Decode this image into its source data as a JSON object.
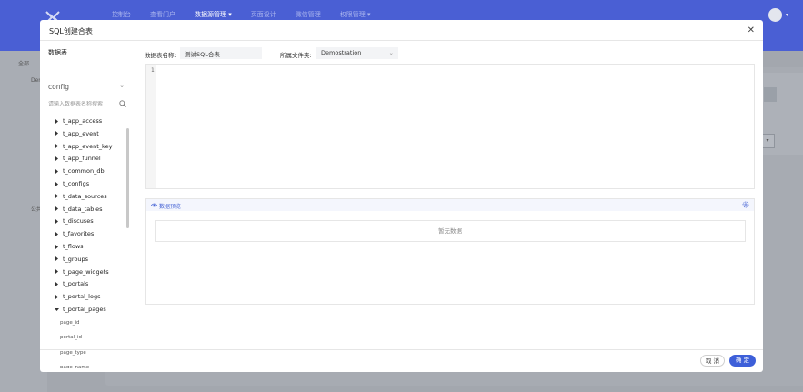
{
  "topbar": {
    "nav": [
      {
        "label": "控制台",
        "active": false
      },
      {
        "label": "查看门户",
        "active": false
      },
      {
        "label": "数据源管理 ▾",
        "active": true
      },
      {
        "label": "页面设计",
        "active": false
      },
      {
        "label": "微信管理",
        "active": false
      },
      {
        "label": "权限管理 ▾",
        "active": false
      }
    ]
  },
  "background": {
    "sidebar": [
      "全部",
      "Dem",
      "公共"
    ]
  },
  "dialog": {
    "title": "SQL创建合表",
    "left": {
      "label": "数据表",
      "source_value": "config",
      "search_placeholder": "请输入数据表名称搜索",
      "tables": [
        {
          "name": "t_app_access",
          "expanded": false
        },
        {
          "name": "t_app_event",
          "expanded": false
        },
        {
          "name": "t_app_event_key",
          "expanded": false
        },
        {
          "name": "t_app_funnel",
          "expanded": false
        },
        {
          "name": "t_common_db",
          "expanded": false
        },
        {
          "name": "t_configs",
          "expanded": false
        },
        {
          "name": "t_data_sources",
          "expanded": false
        },
        {
          "name": "t_data_tables",
          "expanded": false
        },
        {
          "name": "t_discuses",
          "expanded": false
        },
        {
          "name": "t_favorites",
          "expanded": false
        },
        {
          "name": "t_flows",
          "expanded": false
        },
        {
          "name": "t_groups",
          "expanded": false
        },
        {
          "name": "t_page_widgets",
          "expanded": false
        },
        {
          "name": "t_portals",
          "expanded": false
        },
        {
          "name": "t_portal_logs",
          "expanded": false
        },
        {
          "name": "t_portal_pages",
          "expanded": true
        }
      ],
      "fields": [
        "page_id",
        "portal_id",
        "page_type",
        "page_name"
      ]
    },
    "form": {
      "name_label": "数据表名称:",
      "name_value": "测试SQL合表",
      "folder_label": "所属文件夹:",
      "folder_value": "Demostration"
    },
    "editor": {
      "line_number": "1"
    },
    "preview": {
      "title": "数据预览",
      "empty_text": "暂无数据"
    },
    "buttons": {
      "cancel": "取 消",
      "ok": "确 定"
    },
    "colors": {
      "primary": "#3d5fd9",
      "header": "#4a5fd4"
    }
  }
}
